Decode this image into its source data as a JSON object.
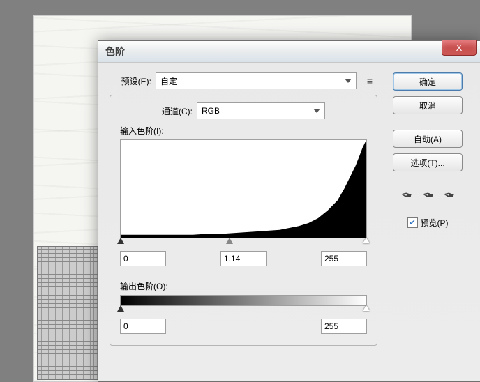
{
  "dialog": {
    "title": "色阶",
    "preset_label": "预设(E):",
    "preset_value": "自定",
    "channel_label": "通道(C):",
    "channel_value": "RGB",
    "input_label": "输入色阶(I):",
    "input_black": "0",
    "input_gamma": "1.14",
    "input_white": "255",
    "output_label": "输出色阶(O):",
    "output_black": "0",
    "output_white": "255"
  },
  "buttons": {
    "ok": "确定",
    "cancel": "取消",
    "auto": "自动(A)",
    "options": "选项(T)...",
    "preview": "预览(P)",
    "close": "X"
  },
  "chart_data": {
    "type": "area",
    "title": "",
    "xlabel": "",
    "ylabel": "",
    "xlim": [
      0,
      255
    ],
    "ylim": [
      0,
      100
    ],
    "x": [
      0,
      15,
      30,
      45,
      60,
      75,
      90,
      105,
      120,
      135,
      150,
      165,
      175,
      185,
      195,
      205,
      215,
      225,
      232,
      238,
      244,
      248,
      251,
      254,
      255
    ],
    "values": [
      3,
      3,
      3,
      3,
      3,
      3,
      4,
      4,
      5,
      6,
      7,
      8,
      10,
      12,
      15,
      20,
      28,
      38,
      50,
      62,
      74,
      84,
      92,
      98,
      100
    ]
  }
}
